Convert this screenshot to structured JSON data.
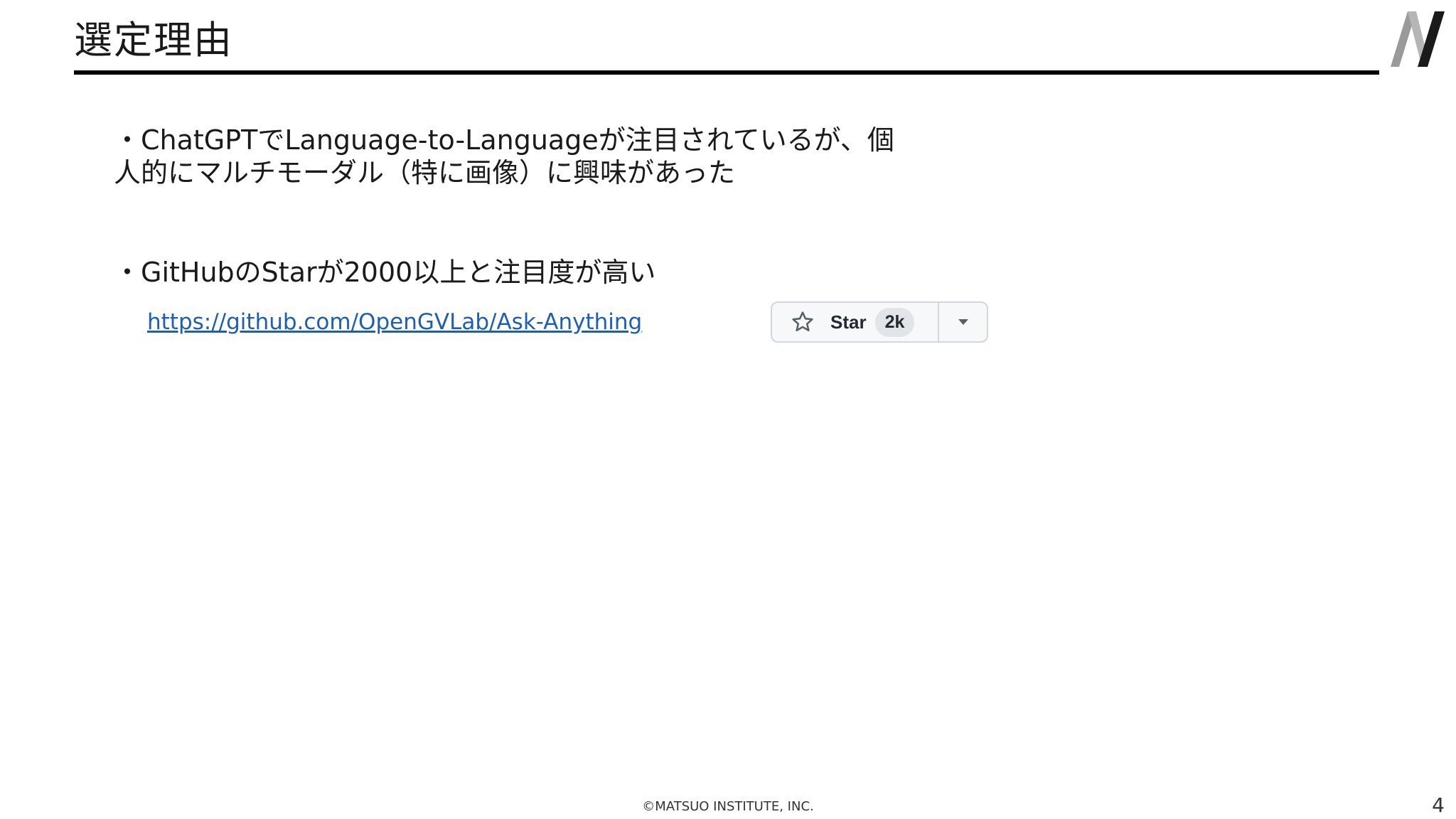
{
  "slide": {
    "title": "選定理由",
    "bullets": [
      "・ChatGPTでLanguage-to-Languageが注目されているが、個人的にマルチモーダル（特に画像）に興味があった",
      "・GitHubのStarが2000以上と注目度が高い"
    ],
    "link": {
      "text": "https://github.com/OpenGVLab/Ask-Anything"
    },
    "star_widget": {
      "icon": "star-outline-icon",
      "label": "Star",
      "count": "2k",
      "dropdown_icon": "caret-down-icon"
    },
    "footer": "©MATSUO INSTITUTE, INC.",
    "page_number": "4",
    "logo_icon": "matsuo-institute-logo",
    "colors": {
      "link": "#1f5fb3",
      "rule": "#000000",
      "widget_border": "#d0d7de",
      "widget_bg": "#f6f8fa",
      "count_bg": "#e1e4e8"
    }
  }
}
